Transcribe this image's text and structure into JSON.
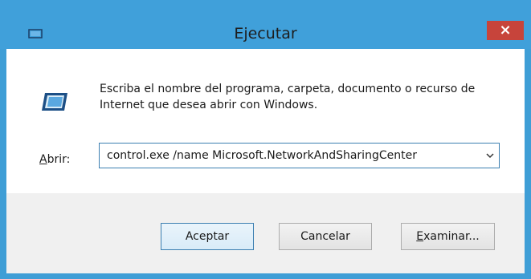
{
  "window": {
    "title": "Ejecutar",
    "close_glyph": "×",
    "icon": "run-icon"
  },
  "dialog": {
    "description": "Escriba el nombre del programa, carpeta, documento o recurso de Internet que desea abrir con Windows.",
    "open_label": "Abrir:",
    "open_value": "control.exe /name Microsoft.NetworkAndSharingCenter"
  },
  "buttons": {
    "ok": "Aceptar",
    "cancel": "Cancelar",
    "browse": "Examinar..."
  },
  "colors": {
    "titlebar": "#40a0da",
    "close": "#c7443b",
    "footer": "#f0f0f0"
  }
}
